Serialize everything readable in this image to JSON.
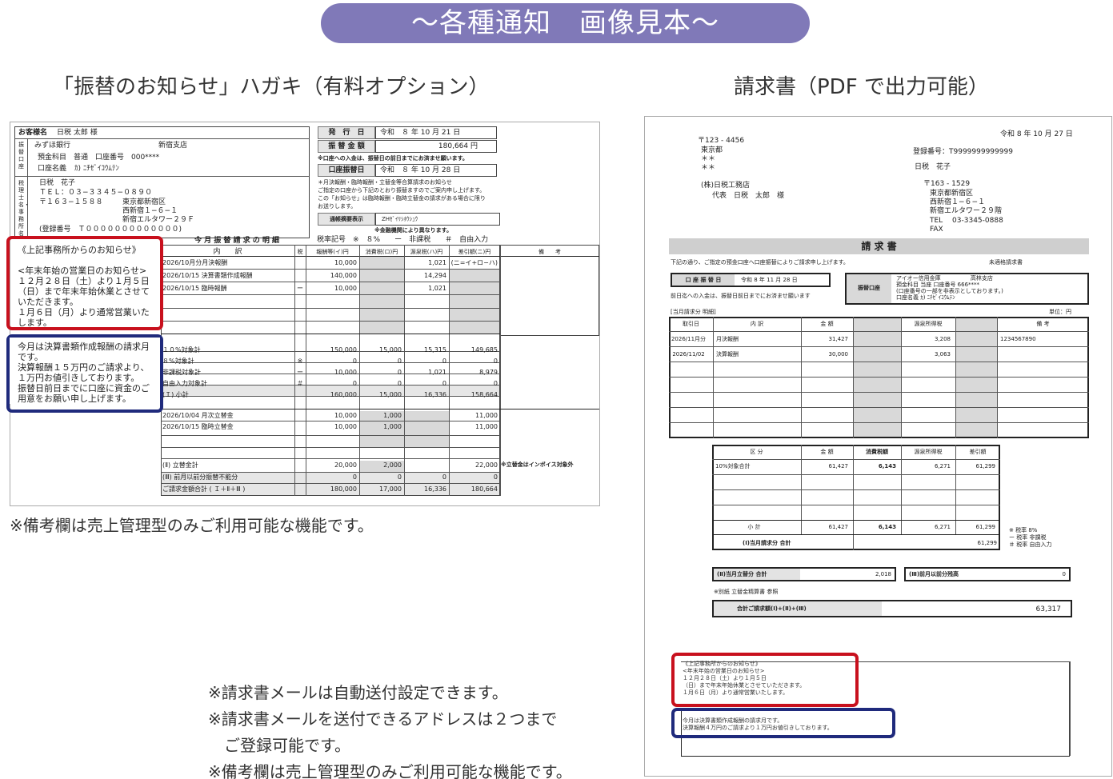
{
  "banner": "〜各種通知　画像見本〜",
  "left": {
    "heading": "「振替のお知らせ」ハガキ（有料オプション）",
    "note": "※備考欄は売上管理型のみご利用可能な機能です。",
    "card": {
      "name_label": "お客様名",
      "name_value": "日税 太郎 様",
      "issue_label": "発　行　日",
      "issue_value": "令和　８ 年 10 月 21 日",
      "amount_label": "振 替 金 額",
      "amount_value": "180,664 円",
      "deposit_note": "※口座への入金は、振替日の前日までにお済ませ願います。",
      "date_label": "口座振替日",
      "date_value": "令和　８ 年 10 月 28 日",
      "side_bank": "振替口座",
      "bank_name": "みずほ銀行",
      "branch": "新宿支店",
      "account_line": "預金科目　普通　口座番号　000****",
      "holder_label": "口座名義",
      "holder_value": "ｶ) ﾆﾁｾﾞｲｺｳﾑﾃﾝ",
      "side_office": "税理士名・事務所名",
      "o1": "日税　花子",
      "o2": "ＴＥＬ：０３−３３４５−０８９０",
      "o3": "〒１６３−１５８８",
      "o4": "東京都新宿区",
      "o5": "西新宿１−６−１",
      "o6": "新宿エルタワー２９Ｆ",
      "o7": "(登録番号　Ｔ０００００００００００００)",
      "info1": "＊月決報酬・臨時報酬・立替金等合算請求のお知らせ",
      "info2": "ご指定の口座から下記のとおり振替ますのでご案内申し上げます。",
      "info3": "この「お知らせ」は臨時報酬・臨時立替金の請求がある場合に限り",
      "info4": "お送りします。",
      "summary_label": "通帳摘要表示",
      "summary_value": "ZHｾﾞｲﾘｼﾎｳｼｭｳ",
      "bank_note": "※金融機関により異なります。",
      "tax_legend": "税率記号　※　８%　　ー　非課税　　＃　自由入力",
      "table_title": "今 月 振 替 請 求 の 明 細",
      "headers": [
        "内　　訳",
        "税",
        "報酬等(イ)円",
        "消費税(ロ)円",
        "源泉税(ハ)円",
        "差引額(ニ)円",
        "備　　考"
      ],
      "rows": [
        [
          "2026/10月分月決報酬",
          "",
          "10,000",
          "",
          "1,021",
          "(ニ=イ+ロ−ハ)"
        ],
        [
          "2026/10/15 決算書類作成報酬",
          "",
          "140,000",
          "",
          "14,294",
          ""
        ],
        [
          "2026/10/15 臨時報酬",
          "ー",
          "10,000",
          "",
          "1,021",
          ""
        ]
      ],
      "sub_rows": [
        [
          "１０%対象計",
          "",
          "150,000",
          "15,000",
          "15,315",
          "149,685"
        ],
        [
          "８%対象計",
          "※",
          "0",
          "0",
          "0",
          "0"
        ],
        [
          "非課税対象計",
          "ー",
          "10,000",
          "0",
          "1,021",
          "8,979"
        ],
        [
          "自由入力対象計",
          "＃",
          "0",
          "0",
          "0",
          "0"
        ],
        [
          "(Ｉ) 小計",
          "",
          "160,000",
          "15,000",
          "16,336",
          "158,664"
        ]
      ],
      "adv_rows": [
        [
          "2026/10/04 月次立替金",
          "",
          "10,000",
          "1,000",
          "",
          "11,000"
        ],
        [
          "2026/10/15 臨時立替金",
          "",
          "10,000",
          "1,000",
          "",
          "11,000"
        ]
      ],
      "tot_rows": [
        [
          "(Ⅱ) 立替金計",
          "",
          "20,000",
          "2,000",
          "",
          "22,000"
        ],
        [
          "(Ⅲ) 前月以前分振替不能分",
          "",
          "0",
          "0",
          "0",
          "0"
        ],
        [
          "ご請求金額合計 ( Ｉ＋Ⅱ＋Ⅲ )",
          "",
          "180,000",
          "17,000",
          "16,336",
          "180,664"
        ]
      ],
      "invoice_note": "※立替金はインボイス対象外",
      "red_lines": [
        "《上記事務所からのお知らせ》",
        "",
        "<年末年始の営業日のお知らせ>",
        "１２月２８日（土）より１月５日",
        "（日）まで年末年始休業とさせて",
        "いただきます。",
        "１月６日（月）より通常営業いた",
        "します。"
      ],
      "blue_lines": [
        "今月は決算書類作成報酬の請求月",
        "です。",
        "決算報酬１５万円のご請求より、",
        "１万円お値引きしております。",
        "振替日前日までに口座に資金のご",
        "用意をお願い申し上げます。"
      ]
    }
  },
  "right": {
    "heading": "請求書（PDF で出力可能）",
    "notes": [
      "※請求書メールは自動送付設定できます。",
      "※請求書メールを送付できるアドレスは２つまで",
      "　ご登録可能です。",
      "※備考欄は売上管理型のみご利用可能な機能です。"
    ],
    "invoice": {
      "date": "令和 8 年 10 月 27 日",
      "zip": "〒123 - 4456",
      "addr1": "東京都",
      "addr2": "＊＊",
      "addr3": "＊＊",
      "client1": "(株)日税工務店",
      "client2": "代表　日税　太郎　様",
      "reg": "登録番号：T9999999999999",
      "issuer": "日税　花子",
      "i1": "〒163 - 1529",
      "i2": "東京都新宿区",
      "i3": "西新宿１−６−１",
      "i4": "新宿エルタワー２９階",
      "i5": "TEL　 03-3345-0888",
      "i6": "FAX",
      "title": "請 求 書",
      "lead": "下記の通り、ご指定の預金口座へ口座振替によりご請求申し上げます。",
      "lead_r": "未適格請求書",
      "date_label": "口 座 振 替 日",
      "date_value": "令和 8 年 11 月 28 日",
      "acct_label": "振替口座",
      "acct1": "アイオー信用金庫　　　　　 高林支店",
      "acct2": "預金科目 当座 口座番号 666****",
      "acct3": "(口座番号の一部を非表示としております。)",
      "acct4": "口座名義 ｶ) ﾆﾁｾﾞｲｺｳﾑﾃﾝ",
      "deposit_note": "前日迄への入金は、振替日前日までにお済ませ願います",
      "detail_label": "[当月請求分 明細]",
      "unit": "単位：円",
      "headers": [
        "取引日",
        "内 訳",
        "金 額",
        "",
        "源泉所得税",
        "",
        "備 考"
      ],
      "rows": [
        [
          "2026/11月分",
          "月決報酬",
          "31,427",
          "",
          "3,208",
          "",
          "1234567890"
        ],
        [
          "2026/11/02",
          "決算報酬",
          "30,000",
          "",
          "3,063",
          "",
          ""
        ]
      ],
      "s_headers": [
        "区 分",
        "金 額",
        "消費税額",
        "源泉所得税",
        "差引額"
      ],
      "s_row": [
        "10%対象合計",
        "61,427",
        "6,143",
        "6,271",
        "61,299"
      ],
      "s_total": [
        "小 計",
        "61,427",
        "6,143",
        "6,271",
        "61,299"
      ],
      "cur_label": "(Ⅰ)当月請求分 合計",
      "cur_value": "61,299",
      "legend1": "※ 税率 8%",
      "legend2": "ー 税率 非課税",
      "legend3": "＃ 税率 自由入力",
      "adv_label": "(Ⅱ)当月立替分 合計",
      "adv_value": "2,018",
      "prev_label": "(Ⅲ)前月以前分残高",
      "prev_value": "0",
      "sep_note": "※別紙 立替金精算書 参照",
      "grand_label": "合計ご請求額(Ⅰ)+(Ⅱ)+(Ⅲ)",
      "grand_value": "63,317",
      "msg_red": [
        "《上記事務所からのお知らせ》",
        "<年末年始の営業日のお知らせ>",
        "１２月２８日（土）より１月５日",
        "（日）まで年末年始休業とさせていただきます。",
        "１月６日（月）より通常営業いたします。"
      ],
      "msg_blue": [
        "今月は決算書類作成報酬の請求月です。",
        "決算報酬４万円のご請求より１万円お値引きしております。"
      ]
    }
  }
}
